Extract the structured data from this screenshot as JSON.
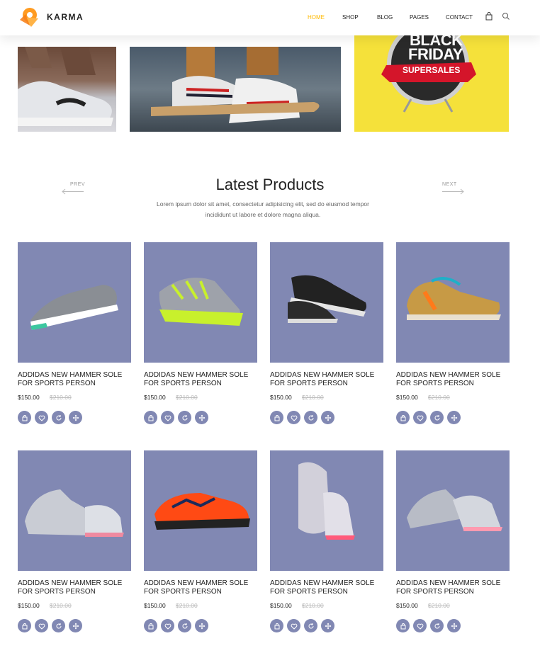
{
  "brand": {
    "name": "KARMA"
  },
  "nav": {
    "items": [
      "HOME",
      "SHOP",
      "BLOG",
      "PAGES",
      "CONTACT"
    ],
    "active": "HOME"
  },
  "colors": {
    "accent": "#ffba00",
    "product_bg": "#8188b3",
    "banner_yellow": "#f5e13a"
  },
  "banners": {
    "black_friday": {
      "line1": "BLACK",
      "line2": "FRIDAY",
      "ribbon": "SUPERSALES"
    }
  },
  "section": {
    "title": "Latest Products",
    "subtitle": "Lorem ipsum dolor sit amet, consectetur adipisicing elit, sed do eiusmod tempor incididunt ut labore et dolore magna aliqua.",
    "prev": "PREV",
    "next": "NEXT"
  },
  "products": [
    {
      "name": "ADDIDAS NEW HAMMER SOLE FOR SPORTS PERSON",
      "price": "$150.00",
      "old_price": "$210.00"
    },
    {
      "name": "ADDIDAS NEW HAMMER SOLE FOR SPORTS PERSON",
      "price": "$150.00",
      "old_price": "$210.00"
    },
    {
      "name": "ADDIDAS NEW HAMMER SOLE FOR SPORTS PERSON",
      "price": "$150.00",
      "old_price": "$210.00"
    },
    {
      "name": "ADDIDAS NEW HAMMER SOLE FOR SPORTS PERSON",
      "price": "$150.00",
      "old_price": "$210.00"
    },
    {
      "name": "ADDIDAS NEW HAMMER SOLE FOR SPORTS PERSON",
      "price": "$150.00",
      "old_price": "$210.00"
    },
    {
      "name": "ADDIDAS NEW HAMMER SOLE FOR SPORTS PERSON",
      "price": "$150.00",
      "old_price": "$210.00"
    },
    {
      "name": "ADDIDAS NEW HAMMER SOLE FOR SPORTS PERSON",
      "price": "$150.00",
      "old_price": "$210.00"
    },
    {
      "name": "ADDIDAS NEW HAMMER SOLE FOR SPORTS PERSON",
      "price": "$150.00",
      "old_price": "$210.00"
    }
  ],
  "product_actions": [
    "shopping-bag-icon",
    "heart-icon",
    "refresh-icon",
    "move-icon"
  ]
}
